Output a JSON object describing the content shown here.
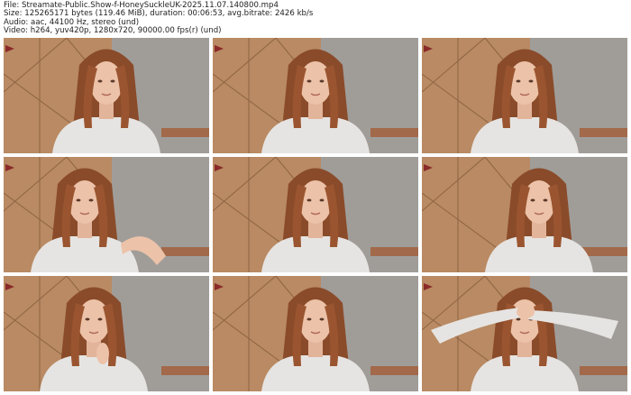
{
  "header": {
    "file": "File: Streamate-Public.Show-f-HoneySuckleUK-2025.11.07.140800.mp4",
    "size": "Size: 125265171 bytes (119.46 MiB), duration: 00:06:53, avg.bitrate: 2426 kb/s",
    "audio": "Audio: aac, 44100 Hz, stereo (und)",
    "video": "Video: h264, yuv420p, 1280x720, 90000.00 fps(r) (und)"
  },
  "thumbnails": [
    {
      "pose": "neutral"
    },
    {
      "pose": "looking-down"
    },
    {
      "pose": "eyes-closed"
    },
    {
      "pose": "head-tilt-hand"
    },
    {
      "pose": "neutral"
    },
    {
      "pose": "turned-right"
    },
    {
      "pose": "hand-at-chin"
    },
    {
      "pose": "neutral"
    },
    {
      "pose": "arms-raised"
    }
  ]
}
